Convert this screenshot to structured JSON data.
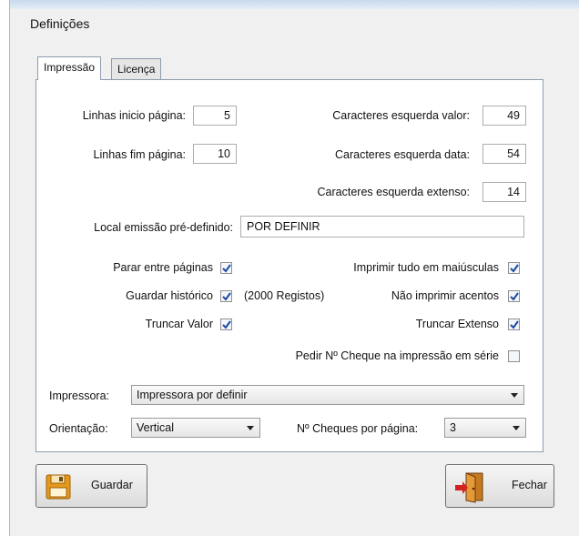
{
  "window": {
    "title": "Definições"
  },
  "tabs": [
    {
      "label": "Impressão",
      "active": true
    },
    {
      "label": "Licença",
      "active": false
    }
  ],
  "fields": {
    "linhas_inicio": {
      "label": "Linhas inicio página:",
      "value": "5"
    },
    "linhas_fim": {
      "label": "Linhas fim página:",
      "value": "10"
    },
    "car_esq_valor": {
      "label": "Caracteres esquerda valor:",
      "value": "49"
    },
    "car_esq_data": {
      "label": "Caracteres esquerda data:",
      "value": "54"
    },
    "car_esq_extenso": {
      "label": "Caracteres esquerda extenso:",
      "value": "14"
    },
    "local_emissao": {
      "label": "Local emissão pré-definido:",
      "value": "POR DEFINIR"
    }
  },
  "checkboxes": {
    "parar_paginas": {
      "label": "Parar entre páginas",
      "checked": true
    },
    "guardar_historico": {
      "label": "Guardar histórico",
      "checked": true,
      "note": "(2000 Registos)"
    },
    "truncar_valor": {
      "label": "Truncar Valor",
      "checked": true
    },
    "maiusculas": {
      "label": "Imprimir tudo em maiúsculas",
      "checked": true
    },
    "sem_acentos": {
      "label": "Não imprimir acentos",
      "checked": true
    },
    "truncar_extenso": {
      "label": "Truncar Extenso",
      "checked": true
    },
    "pedir_cheque": {
      "label": "Pedir Nº Cheque na impressão em série",
      "checked": false
    }
  },
  "selects": {
    "impressora": {
      "label": "Impressora:",
      "value": "Impressora por definir"
    },
    "orientacao": {
      "label": "Orientação:",
      "value": "Vertical"
    },
    "cheques_pagina": {
      "label": "Nº Cheques por página:",
      "value": "3"
    }
  },
  "buttons": {
    "guardar": {
      "label": "Guardar",
      "icon": "floppy-disk-icon"
    },
    "fechar": {
      "label": "Fechar",
      "icon": "exit-door-icon"
    }
  },
  "colors": {
    "check": "#1b4aa0",
    "border": "#8e9cae"
  }
}
